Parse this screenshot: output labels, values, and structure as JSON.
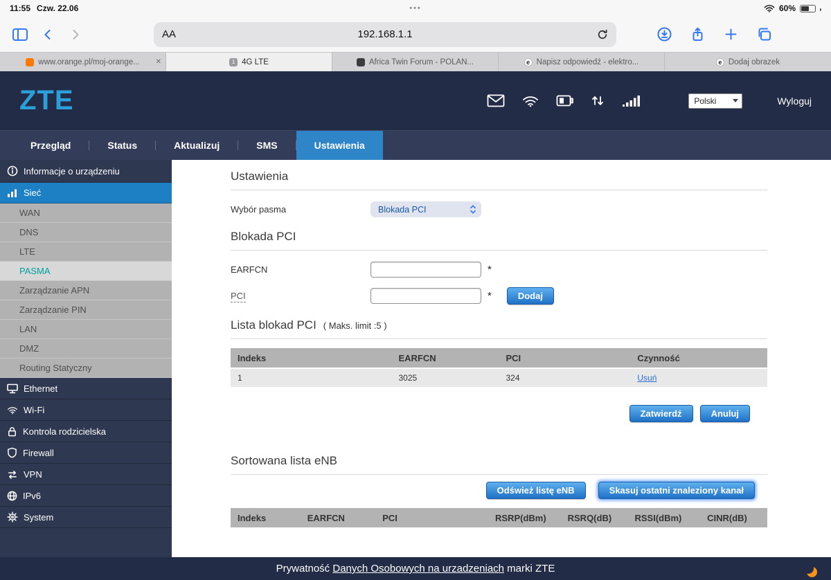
{
  "status_bar": {
    "time": "11:55",
    "date": "Czw. 22.06",
    "dots": "•••",
    "battery_pct": "60%"
  },
  "toolbar": {
    "reader_label": "AA",
    "url": "192.168.1.1"
  },
  "icons": {
    "close_glyph": "✕"
  },
  "tabs": [
    {
      "label": "www.orange.pl/moj-orange...",
      "favicon": "orange-logo"
    },
    {
      "label": "4G LTE",
      "favicon": "router-page",
      "favicon_text": "1"
    },
    {
      "label": "Africa Twin Forum - POLAN...",
      "favicon": "forum-logo"
    },
    {
      "label": "Napisz odpowiedź - elektro...",
      "favicon": "electroda-logo",
      "favicon_text": "e"
    },
    {
      "label": "Dodaj obrazek",
      "favicon": "electroda-logo",
      "favicon_text": "e"
    }
  ],
  "site": {
    "logo": "ZTE",
    "language": "Polski",
    "logout": "Wyloguj",
    "nav": [
      "Przegląd",
      "Status",
      "Aktualizuj",
      "SMS",
      "Ustawienia"
    ],
    "sidebar": {
      "info": "Informacje o urządzeniu",
      "network": "Sieć",
      "network_sub": [
        "WAN",
        "DNS",
        "LTE",
        "PASMA",
        "Zarządzanie APN",
        "Zarządzanie PIN",
        "LAN",
        "DMZ",
        "Routing Statyczny"
      ],
      "sections": [
        "Ethernet",
        "Wi-Fi",
        "Kontrola rodzicielska",
        "Firewall",
        "VPN",
        "IPv6",
        "System"
      ]
    },
    "content": {
      "title": "Ustawienia",
      "band_label": "Wybór pasma",
      "band_value": "Blokada PCI",
      "pci_section": "Blokada PCI",
      "earfcn_label": "EARFCN",
      "pci_label": "PCI",
      "required": "*",
      "add": "Dodaj",
      "list_title": "Lista blokad PCI",
      "list_limit": "( Maks. limit :5 )",
      "pci_headers": [
        "Indeks",
        "EARFCN",
        "PCI",
        "Czynność"
      ],
      "pci_row": {
        "indeks": "1",
        "earfcn": "3025",
        "pci": "324",
        "action": "Usuń"
      },
      "apply": "Zatwierdź",
      "cancel": "Anuluj",
      "enb_title": "Sortowana lista eNB",
      "refresh": "Odśwież listę eNB",
      "clear": "Skasuj ostatni znaleziony kanał",
      "enb_headers": [
        "Indeks",
        "EARFCN",
        "PCI",
        "RSRP(dBm)",
        "RSRQ(dB)",
        "RSSI(dBm)",
        "CINR(dB)"
      ]
    },
    "footer": {
      "prefix": "Prywatność ",
      "link": "Danych Osobowych na urzadzeniach",
      "suffix": " marki ZTE"
    }
  },
  "colors": {
    "navy": "#232c46",
    "sidebar_navy": "#2e3850",
    "nav_active_blue": "#2e86c8",
    "button_blue": "#1f72c6",
    "logo_blue": "#2b9fd9",
    "submenu_active_teal": "#00a0a0",
    "ios_blue": "#3478f6",
    "orange_brand": "#ff7900",
    "link_blue": "#2a6fd0"
  }
}
